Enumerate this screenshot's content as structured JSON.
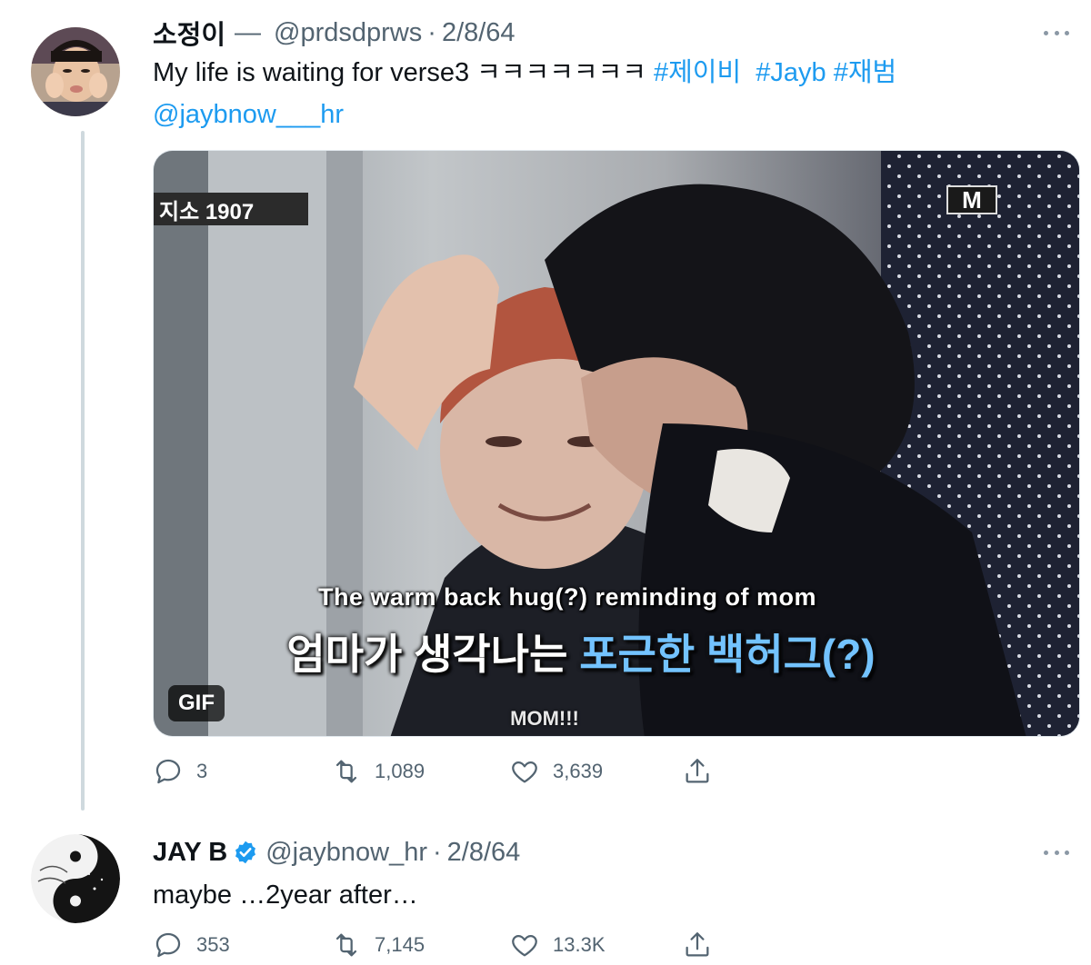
{
  "tweet1": {
    "display_name": "소정이",
    "name_dash": "—",
    "handle": "@prdsdprws",
    "separator": "·",
    "date": "2/8/64",
    "text_plain": "My life is waiting for verse3 ㅋㅋㅋㅋㅋㅋㅋ ",
    "hashtags": [
      "#제이비",
      "#Jayb",
      "#재범"
    ],
    "mention": "@jaybnow___hr",
    "media": {
      "caption_en": "The warm back hug(?) reminding of mom",
      "caption_ko_plain": "엄마가 생각나는 ",
      "caption_ko_highlight": "포근한 백허그(?)",
      "caption_bottom": "MOM!!!",
      "badge": "GIF",
      "logo": "M",
      "show_title": "지소 1907"
    },
    "stats": {
      "replies": "3",
      "retweets": "1,089",
      "likes": "3,639"
    }
  },
  "tweet2": {
    "display_name": "JAY B",
    "handle": "@jaybnow_hr",
    "separator": "·",
    "date": "2/8/64",
    "text": "maybe …2year after…",
    "stats": {
      "replies": "353",
      "retweets": "7,145",
      "likes": "13.3K"
    }
  },
  "icons": {
    "reply": "reply-icon",
    "retweet": "retweet-icon",
    "like": "heart-icon",
    "share": "share-icon",
    "more": "more-icon",
    "verified": "verified-badge-icon"
  },
  "colors": {
    "link": "#1d9bf0",
    "secondary_text": "#536471",
    "thread_line": "#cfd9de",
    "verified": "#1d9bf0"
  }
}
